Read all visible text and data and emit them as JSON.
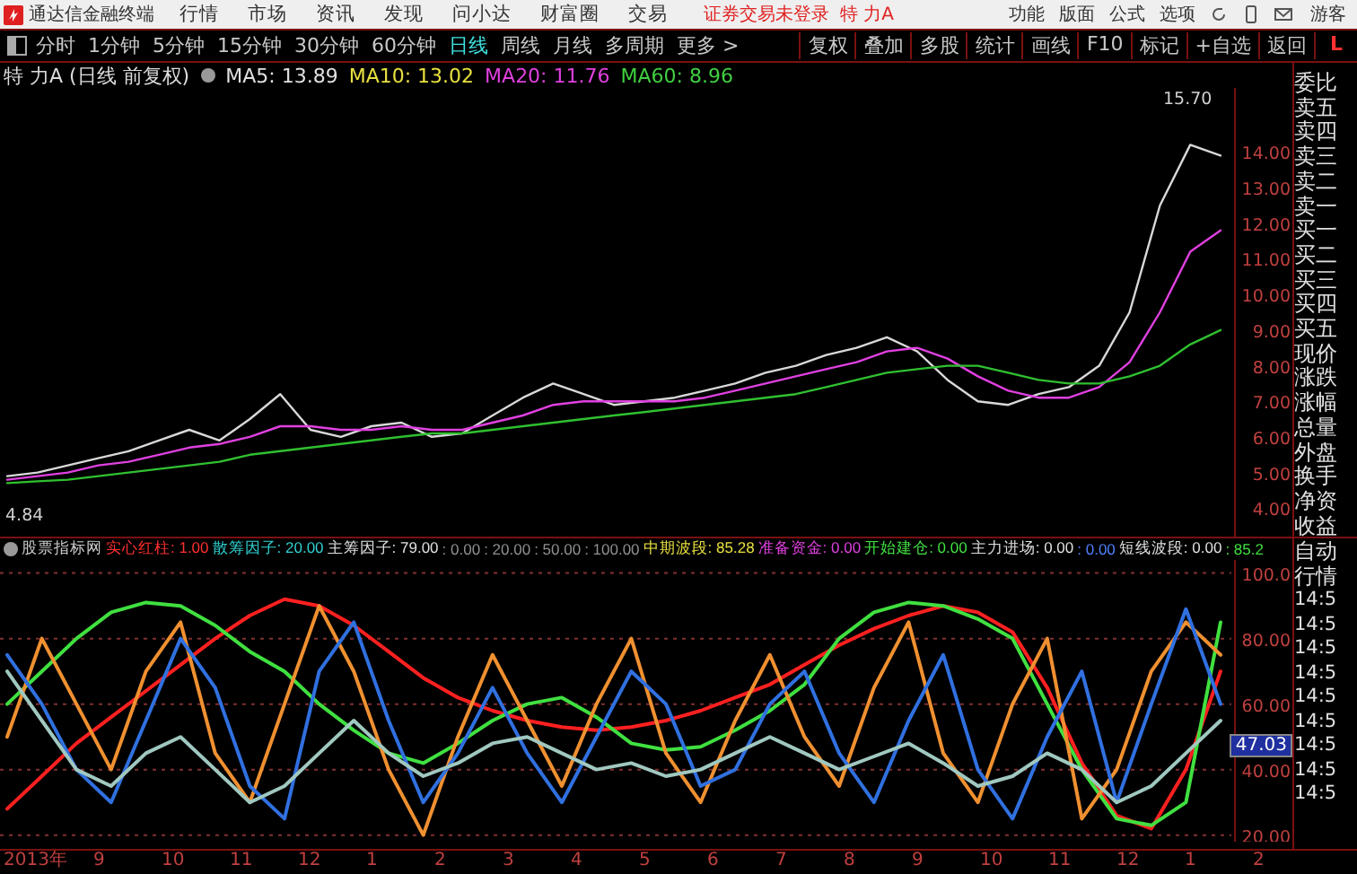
{
  "menu_bar": {
    "app_title": "通达信金融终端",
    "items": [
      "行情",
      "市场",
      "资讯",
      "发现",
      "问小达",
      "财富圈",
      "交易"
    ],
    "login_status": "证券交易未登录",
    "stock": "特 力A",
    "right_items": [
      "功能",
      "版面",
      "公式",
      "选项"
    ],
    "user": "游客"
  },
  "period_bar": {
    "periods": [
      {
        "label": "分时",
        "selected": false
      },
      {
        "label": "1分钟",
        "selected": false
      },
      {
        "label": "5分钟",
        "selected": false
      },
      {
        "label": "15分钟",
        "selected": false
      },
      {
        "label": "30分钟",
        "selected": false
      },
      {
        "label": "60分钟",
        "selected": false
      },
      {
        "label": "日线",
        "selected": true
      },
      {
        "label": "周线",
        "selected": false
      },
      {
        "label": "月线",
        "selected": false
      },
      {
        "label": "多周期",
        "selected": false
      },
      {
        "label": "更多 >",
        "selected": false
      }
    ],
    "tools": [
      "复权",
      "叠加",
      "多股",
      "统计",
      "画线",
      "F10",
      "标记",
      "+自选",
      "返回"
    ],
    "corner": "L"
  },
  "price_panel": {
    "title": "特 力A (日线 前复权)",
    "mas": [
      {
        "label": "MA5: 13.89",
        "color": "#e0e0e0"
      },
      {
        "label": "MA10: 13.02",
        "color": "#e8e040"
      },
      {
        "label": "MA20: 11.76",
        "color": "#e040e0"
      },
      {
        "label": "MA60: 8.96",
        "color": "#40d040"
      }
    ],
    "high_label": "15.70",
    "low_label": "4.84",
    "chart_data": {
      "type": "line",
      "ylim": [
        3.2,
        15.8
      ],
      "yticks": [
        {
          "value": 4,
          "label": "4.00"
        },
        {
          "value": 5,
          "label": "5.00"
        },
        {
          "value": 6,
          "label": "6.00"
        },
        {
          "value": 7,
          "label": "7.00"
        },
        {
          "value": 8,
          "label": "8.00"
        },
        {
          "value": 9,
          "label": "9.00"
        },
        {
          "value": 10,
          "label": "10.00"
        },
        {
          "value": 11,
          "label": "11.00"
        },
        {
          "value": 12,
          "label": "12.00"
        },
        {
          "value": 13,
          "label": "13.00"
        },
        {
          "value": 14,
          "label": "14.00"
        }
      ],
      "series": [
        {
          "color": "#d8d8d8",
          "values": [
            4.9,
            5.0,
            5.2,
            5.4,
            5.6,
            5.9,
            6.2,
            5.9,
            6.5,
            7.2,
            6.2,
            6.0,
            6.3,
            6.4,
            6.0,
            6.1,
            6.6,
            7.1,
            7.5,
            7.2,
            6.9,
            7.0,
            7.1,
            7.3,
            7.5,
            7.8,
            8.0,
            8.3,
            8.5,
            8.8,
            8.4,
            7.6,
            7.0,
            6.9,
            7.2,
            7.4,
            8.0,
            9.5,
            12.5,
            14.2,
            13.9
          ]
        },
        {
          "color": "#e040e0",
          "values": [
            4.8,
            4.9,
            5.0,
            5.2,
            5.3,
            5.5,
            5.7,
            5.8,
            6.0,
            6.3,
            6.3,
            6.2,
            6.2,
            6.3,
            6.2,
            6.2,
            6.4,
            6.6,
            6.9,
            7.0,
            7.0,
            7.0,
            7.0,
            7.1,
            7.3,
            7.5,
            7.7,
            7.9,
            8.1,
            8.4,
            8.5,
            8.2,
            7.7,
            7.3,
            7.1,
            7.1,
            7.4,
            8.1,
            9.5,
            11.2,
            11.8
          ]
        },
        {
          "color": "#30c030",
          "values": [
            4.7,
            4.75,
            4.8,
            4.9,
            5.0,
            5.1,
            5.2,
            5.3,
            5.5,
            5.6,
            5.7,
            5.8,
            5.9,
            6.0,
            6.1,
            6.1,
            6.2,
            6.3,
            6.4,
            6.5,
            6.6,
            6.7,
            6.8,
            6.9,
            7.0,
            7.1,
            7.2,
            7.4,
            7.6,
            7.8,
            7.9,
            8.0,
            8.0,
            7.8,
            7.6,
            7.5,
            7.5,
            7.7,
            8.0,
            8.6,
            9.0
          ]
        }
      ]
    }
  },
  "quote_panel": [
    "委比",
    "卖五",
    "卖四",
    "卖三",
    "卖二",
    "卖一",
    "买一",
    "买二",
    "买三",
    "买四",
    "买五",
    "现价",
    "涨跌",
    "涨幅",
    "总量",
    "外盘",
    "换手",
    "净资",
    "收益"
  ],
  "indicator_panel": {
    "name": "股票指标网",
    "legend": [
      {
        "text": "实心红柱: 1.00",
        "color": "#ff3030"
      },
      {
        "text": "散筹因子: 20.00",
        "color": "#30d0d0"
      },
      {
        "text": "主筹因子: 79.00",
        "color": "#e0e0e0"
      },
      {
        "text": ": 0.00",
        "color": "#909090"
      },
      {
        "text": ": 20.00",
        "color": "#909090"
      },
      {
        "text": ": 50.00",
        "color": "#909090"
      },
      {
        "text": ": 100.00",
        "color": "#909090"
      },
      {
        "text": "中期波段: 85.28",
        "color": "#e8e040"
      },
      {
        "text": "准备资金: 0.00",
        "color": "#e040e0"
      },
      {
        "text": "开始建仓: 0.00",
        "color": "#40e040"
      },
      {
        "text": "主力进场: 0.00",
        "color": "#e0e0e0"
      },
      {
        "text": ": 0.00",
        "color": "#5080ff"
      },
      {
        "text": "短线波段: 0.00",
        "color": "#e0e0e0"
      },
      {
        "text": ": 85.2",
        "color": "#40e040"
      }
    ],
    "current_value": "47.03",
    "chart_data": {
      "type": "line",
      "grid": true,
      "ylim": [
        18,
        104
      ],
      "yticks": [
        {
          "value": 20,
          "label": "20.00"
        },
        {
          "value": 40,
          "label": "40.00"
        },
        {
          "value": 60,
          "label": "60.00"
        },
        {
          "value": 80,
          "label": "80.00"
        },
        {
          "value": 100,
          "label": "100.0"
        }
      ],
      "series": [
        {
          "color": "#ff2020",
          "values": [
            28,
            38,
            48,
            56,
            64,
            72,
            80,
            87,
            92,
            90,
            84,
            76,
            68,
            62,
            58,
            55,
            53,
            52,
            53,
            55,
            58,
            62,
            66,
            72,
            78,
            83,
            87,
            90,
            88,
            82,
            65,
            42,
            26,
            22,
            40,
            70
          ]
        },
        {
          "color": "#40e040",
          "values": [
            60,
            70,
            80,
            88,
            91,
            90,
            84,
            76,
            70,
            60,
            52,
            45,
            42,
            48,
            55,
            60,
            62,
            56,
            48,
            46,
            47,
            52,
            58,
            66,
            80,
            88,
            91,
            90,
            86,
            80,
            60,
            40,
            25,
            23,
            30,
            85
          ]
        },
        {
          "color": "#f09030",
          "values": [
            50,
            80,
            60,
            40,
            70,
            85,
            45,
            30,
            60,
            90,
            70,
            40,
            20,
            50,
            75,
            55,
            35,
            60,
            80,
            45,
            30,
            55,
            75,
            50,
            35,
            65,
            85,
            45,
            30,
            60,
            80,
            25,
            40,
            70,
            85,
            75
          ]
        },
        {
          "color": "#3070e0",
          "values": [
            75,
            60,
            40,
            30,
            55,
            80,
            65,
            35,
            25,
            70,
            85,
            55,
            30,
            45,
            65,
            45,
            30,
            50,
            70,
            60,
            35,
            40,
            60,
            70,
            45,
            30,
            55,
            75,
            40,
            25,
            50,
            70,
            30,
            60,
            89,
            60
          ]
        },
        {
          "color": "#a0c8c0",
          "values": [
            70,
            55,
            40,
            35,
            45,
            50,
            40,
            30,
            35,
            45,
            55,
            45,
            38,
            42,
            48,
            50,
            45,
            40,
            42,
            38,
            40,
            45,
            50,
            45,
            40,
            44,
            48,
            42,
            35,
            38,
            45,
            40,
            30,
            35,
            45,
            55
          ]
        }
      ]
    },
    "side_labels": [
      "自动",
      "行情"
    ],
    "times": [
      "14:5",
      "14:5",
      "14:5",
      "14:5",
      "14:5",
      "14:5",
      "14:5",
      "14:5",
      "14:5"
    ]
  },
  "date_axis": [
    "2013年",
    "9",
    "10",
    "11",
    "12",
    "1",
    "2",
    "3",
    "4",
    "5",
    "6",
    "7",
    "8",
    "9",
    "10",
    "11",
    "12",
    "1",
    "2"
  ]
}
